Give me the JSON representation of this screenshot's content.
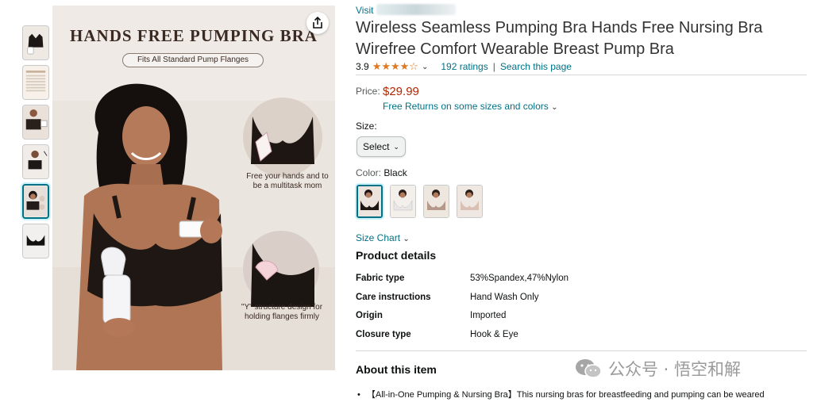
{
  "thumbnails": [
    {
      "label": "black bra with pump"
    },
    {
      "label": "size chart"
    },
    {
      "label": "model front"
    },
    {
      "label": "model side"
    },
    {
      "label": "model hands free",
      "selected": true
    },
    {
      "label": "black bra flat"
    }
  ],
  "main_image": {
    "title": "HANDS FREE PUMPING BRA",
    "subtitle": "Fits All Standard Pump Flanges",
    "caption1": "Free your hands and to be a multitask mom",
    "caption2": "\"Y\" structure design for holding flanges firmly"
  },
  "product": {
    "visit_prefix": "Visit",
    "title": "Wireless Seamless Pumping Bra Hands Free Nursing Bra Wirefree Comfort Wearable Breast Pump Bra",
    "rating": "3.9",
    "stars": "★★★★☆",
    "ratings_count": "192 ratings",
    "separator": "|",
    "search_link": "Search this page",
    "price_label": "Price:",
    "price": "$29.99",
    "returns": "Free Returns on some sizes and colors",
    "size_label": "Size:",
    "size_select": "Select",
    "color_label": "Color:",
    "color_value": "Black",
    "swatches": [
      "Black",
      "White",
      "Beige",
      "Nude"
    ],
    "size_chart": "Size Chart",
    "details_title": "Product details",
    "details": [
      {
        "key": "Fabric type",
        "value": "53%Spandex,47%Nylon"
      },
      {
        "key": "Care instructions",
        "value": "Hand Wash Only"
      },
      {
        "key": "Origin",
        "value": "Imported"
      },
      {
        "key": "Closure type",
        "value": "Hook & Eye"
      }
    ],
    "about_title": "About this item",
    "bullet1": "【All-in-One Pumping & Nursing Bra】This nursing bras for breastfeeding and pumping can be weared"
  },
  "watermark": {
    "text": "公众号 · 悟空和解"
  },
  "colors": {
    "link": "#007185",
    "price": "#b12704",
    "star": "#de7921",
    "selected_border": "#007185"
  },
  "icons": [
    "share-icon",
    "chevron-down-icon",
    "star-icon",
    "wechat-logo-icon"
  ]
}
